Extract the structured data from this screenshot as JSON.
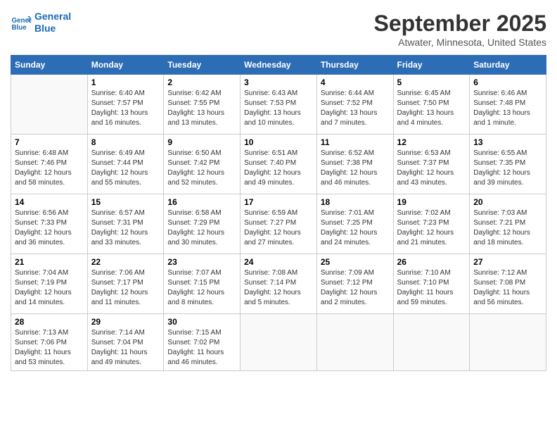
{
  "header": {
    "logo_line1": "General",
    "logo_line2": "Blue",
    "month": "September 2025",
    "location": "Atwater, Minnesota, United States"
  },
  "weekdays": [
    "Sunday",
    "Monday",
    "Tuesday",
    "Wednesday",
    "Thursday",
    "Friday",
    "Saturday"
  ],
  "weeks": [
    [
      {
        "day": "",
        "info": ""
      },
      {
        "day": "1",
        "info": "Sunrise: 6:40 AM\nSunset: 7:57 PM\nDaylight: 13 hours\nand 16 minutes."
      },
      {
        "day": "2",
        "info": "Sunrise: 6:42 AM\nSunset: 7:55 PM\nDaylight: 13 hours\nand 13 minutes."
      },
      {
        "day": "3",
        "info": "Sunrise: 6:43 AM\nSunset: 7:53 PM\nDaylight: 13 hours\nand 10 minutes."
      },
      {
        "day": "4",
        "info": "Sunrise: 6:44 AM\nSunset: 7:52 PM\nDaylight: 13 hours\nand 7 minutes."
      },
      {
        "day": "5",
        "info": "Sunrise: 6:45 AM\nSunset: 7:50 PM\nDaylight: 13 hours\nand 4 minutes."
      },
      {
        "day": "6",
        "info": "Sunrise: 6:46 AM\nSunset: 7:48 PM\nDaylight: 13 hours\nand 1 minute."
      }
    ],
    [
      {
        "day": "7",
        "info": "Sunrise: 6:48 AM\nSunset: 7:46 PM\nDaylight: 12 hours\nand 58 minutes."
      },
      {
        "day": "8",
        "info": "Sunrise: 6:49 AM\nSunset: 7:44 PM\nDaylight: 12 hours\nand 55 minutes."
      },
      {
        "day": "9",
        "info": "Sunrise: 6:50 AM\nSunset: 7:42 PM\nDaylight: 12 hours\nand 52 minutes."
      },
      {
        "day": "10",
        "info": "Sunrise: 6:51 AM\nSunset: 7:40 PM\nDaylight: 12 hours\nand 49 minutes."
      },
      {
        "day": "11",
        "info": "Sunrise: 6:52 AM\nSunset: 7:38 PM\nDaylight: 12 hours\nand 46 minutes."
      },
      {
        "day": "12",
        "info": "Sunrise: 6:53 AM\nSunset: 7:37 PM\nDaylight: 12 hours\nand 43 minutes."
      },
      {
        "day": "13",
        "info": "Sunrise: 6:55 AM\nSunset: 7:35 PM\nDaylight: 12 hours\nand 39 minutes."
      }
    ],
    [
      {
        "day": "14",
        "info": "Sunrise: 6:56 AM\nSunset: 7:33 PM\nDaylight: 12 hours\nand 36 minutes."
      },
      {
        "day": "15",
        "info": "Sunrise: 6:57 AM\nSunset: 7:31 PM\nDaylight: 12 hours\nand 33 minutes."
      },
      {
        "day": "16",
        "info": "Sunrise: 6:58 AM\nSunset: 7:29 PM\nDaylight: 12 hours\nand 30 minutes."
      },
      {
        "day": "17",
        "info": "Sunrise: 6:59 AM\nSunset: 7:27 PM\nDaylight: 12 hours\nand 27 minutes."
      },
      {
        "day": "18",
        "info": "Sunrise: 7:01 AM\nSunset: 7:25 PM\nDaylight: 12 hours\nand 24 minutes."
      },
      {
        "day": "19",
        "info": "Sunrise: 7:02 AM\nSunset: 7:23 PM\nDaylight: 12 hours\nand 21 minutes."
      },
      {
        "day": "20",
        "info": "Sunrise: 7:03 AM\nSunset: 7:21 PM\nDaylight: 12 hours\nand 18 minutes."
      }
    ],
    [
      {
        "day": "21",
        "info": "Sunrise: 7:04 AM\nSunset: 7:19 PM\nDaylight: 12 hours\nand 14 minutes."
      },
      {
        "day": "22",
        "info": "Sunrise: 7:06 AM\nSunset: 7:17 PM\nDaylight: 12 hours\nand 11 minutes."
      },
      {
        "day": "23",
        "info": "Sunrise: 7:07 AM\nSunset: 7:15 PM\nDaylight: 12 hours\nand 8 minutes."
      },
      {
        "day": "24",
        "info": "Sunrise: 7:08 AM\nSunset: 7:14 PM\nDaylight: 12 hours\nand 5 minutes."
      },
      {
        "day": "25",
        "info": "Sunrise: 7:09 AM\nSunset: 7:12 PM\nDaylight: 12 hours\nand 2 minutes."
      },
      {
        "day": "26",
        "info": "Sunrise: 7:10 AM\nSunset: 7:10 PM\nDaylight: 11 hours\nand 59 minutes."
      },
      {
        "day": "27",
        "info": "Sunrise: 7:12 AM\nSunset: 7:08 PM\nDaylight: 11 hours\nand 56 minutes."
      }
    ],
    [
      {
        "day": "28",
        "info": "Sunrise: 7:13 AM\nSunset: 7:06 PM\nDaylight: 11 hours\nand 53 minutes."
      },
      {
        "day": "29",
        "info": "Sunrise: 7:14 AM\nSunset: 7:04 PM\nDaylight: 11 hours\nand 49 minutes."
      },
      {
        "day": "30",
        "info": "Sunrise: 7:15 AM\nSunset: 7:02 PM\nDaylight: 11 hours\nand 46 minutes."
      },
      {
        "day": "",
        "info": ""
      },
      {
        "day": "",
        "info": ""
      },
      {
        "day": "",
        "info": ""
      },
      {
        "day": "",
        "info": ""
      }
    ]
  ]
}
